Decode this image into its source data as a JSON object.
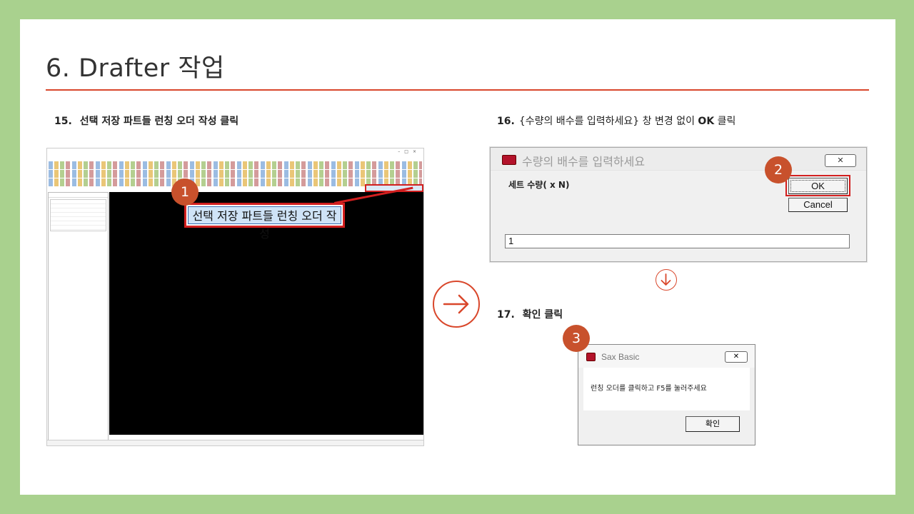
{
  "title": "6. Drafter 작업",
  "colors": {
    "accent": "#d9472b",
    "badge": "#c8512c",
    "highlight": "#d21f1f",
    "frame": "#a9d18e"
  },
  "step15": {
    "num": "15.",
    "text": "선택 저장 파트들 런칭 오더 작성 클릭",
    "callout": "선택 저장 파트들 런칭 오더 작성",
    "badge": "1"
  },
  "step16": {
    "num": "16.",
    "text_pre": "{수량의 배수를 입력하세요} 창 변경 없이 ",
    "text_bold": "OK",
    "text_post": " 클릭",
    "badge": "2",
    "dialog": {
      "title": "수량의 배수를 입력하세요",
      "label": "세트 수량( x N)",
      "ok": "OK",
      "cancel": "Cancel",
      "input_value": "1"
    }
  },
  "step17": {
    "num": "17.",
    "text": "확인 클릭",
    "badge": "3",
    "msgbox": {
      "title": "Sax Basic",
      "message": "런칭 오더를 클릭하고 F5를 눌러주세요",
      "ok": "확인"
    }
  }
}
